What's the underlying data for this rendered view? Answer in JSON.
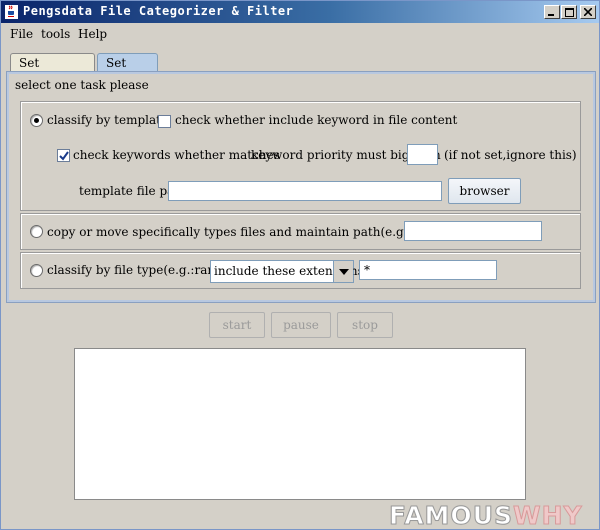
{
  "window": {
    "title": "Pengsdata File Categorizer & Filter",
    "controls": {
      "minimize_icon": "minimize-icon",
      "maximize_icon": "maximize-icon",
      "close_icon": "close-icon"
    }
  },
  "menu": [
    {
      "label": "File"
    },
    {
      "label": "tools"
    },
    {
      "label": "Help"
    }
  ],
  "tabs": [
    {
      "label": "Set Directory",
      "active": false
    },
    {
      "label": "Set Task",
      "active": true
    }
  ],
  "task": {
    "prompt": "select one task please",
    "template": {
      "radio_label": "classify by template",
      "selected": true,
      "content_check_label": "check whether include keyword in file content",
      "content_checked": false,
      "keyword_check_label": "check keywords whether matches",
      "keyword_checked": true,
      "priority_label": "keyword priority must big than",
      "priority_value": "",
      "priority_hint": "(if not set,ignore this)",
      "path_label": "template file path",
      "path_value": "",
      "browse_label": "browser"
    },
    "copy_move": {
      "radio_label": "copy or move specifically types files and maintain path(e.g.:txt|htm|doc)",
      "selected": false,
      "value": ""
    },
    "file_type": {
      "radio_label": "classify by file type(e.g.:rar|exe)",
      "selected": false,
      "mode_selected": "include these extensions",
      "value": "*"
    }
  },
  "actions": {
    "start_label": "start",
    "pause_label": "pause",
    "stop_label": "stop"
  },
  "watermark": {
    "part1": "FAMOUS",
    "part2": "WHY"
  },
  "colors": {
    "titlebar_start": "#0a246a",
    "titlebar_end": "#a6caf0",
    "active_tab": "#b9cfe8",
    "panel_bg": "#d4d0c8"
  }
}
